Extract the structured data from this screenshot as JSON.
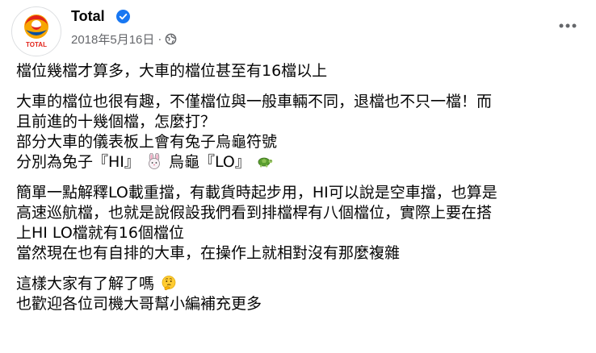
{
  "post": {
    "author": "Total",
    "avatar_text": "TOTAL",
    "date": "2018年5月16日",
    "separator": "·",
    "privacy_icon": "globe-icon",
    "more_icon": "more-options-icon"
  },
  "content": {
    "p1": [
      "檔位幾檔才算多，大車的檔位甚至有16檔以上"
    ],
    "p2": [
      "大車的檔位也很有趣，不僅檔位與一般車輛不同，退檔也不只一檔！而",
      "且前進的十幾個檔，怎麼打？",
      "部分大車的儀表板上會有兔子烏龜符號"
    ],
    "p2_last": {
      "part1": "分別為兔子『HI』",
      "emoji1": "rabbit-face-emoji",
      "part2": " 烏龜『LO』",
      "emoji2": "turtle-emoji"
    },
    "p3": [
      "簡單一點解釋LO載重擋，有載貨時起步用，HI可以說是空車擋，也算是",
      "高速巡航檔，也就是說假設我們看到排檔桿有八個檔位，實際上要在搭",
      "上HI LO檔就有16個檔位",
      "當然現在也有自排的大車，在操作上就相對沒有那麼複雜"
    ],
    "p4_first": {
      "text": "這樣大家有了解了嗎",
      "emoji": "thinking-face-emoji"
    },
    "p4_rest": [
      "也歡迎各位司機大哥幫小編補充更多"
    ]
  },
  "colors": {
    "text": "#050505",
    "meta": "#65676b",
    "verified": "#1877f2",
    "total_red": "#e2231a",
    "total_orange": "#f7a600",
    "total_blue": "#0a4f9e"
  }
}
